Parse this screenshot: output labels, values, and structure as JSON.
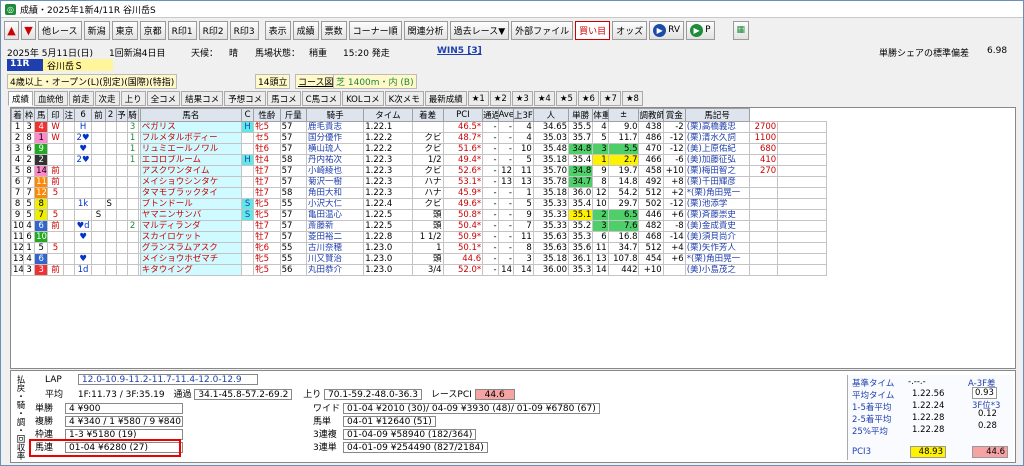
{
  "window": {
    "title": "成績・2025年1新4/11R 谷川岳S"
  },
  "toolbar": {
    "row1": [
      "他レース",
      "新潟",
      "東京",
      "京都",
      "R印1",
      "R印2",
      "R印3",
      "表示",
      "成績",
      "票数",
      "コーナー順",
      "関連分析",
      "過去レース▼",
      "外部ファイル",
      "買い目",
      "オッズ",
      "RV",
      "P"
    ]
  },
  "race": {
    "date": "2025年 5月11日(日)",
    "meeting": "1回新潟4日目",
    "weather_label": "天候：",
    "weather": "晴",
    "track_label": "馬場状態：",
    "track": "稍重",
    "start": "15:20 発走",
    "win5": "WIN5 [3]",
    "share_label": "単勝シェアの標準偏差",
    "share_value": "6.98",
    "number": "11R",
    "name": "谷川岳Ｓ",
    "condition": "4歳以上・オープン(L)(別定)(国際)(特指)",
    "runners": "14頭立",
    "course_label": "コース図",
    "course": "芝 1400m・内 (B)"
  },
  "tabs": [
    "成績",
    "血統他",
    "前走",
    "次走",
    "上り",
    "全コメ",
    "結果コメ",
    "予想コメ",
    "馬コメ",
    "C馬コメ",
    "KOLコメ",
    "K次メモ",
    "最新成績",
    "★1",
    "★2",
    "★3",
    "★4",
    "★5",
    "★6",
    "★7",
    "★8"
  ],
  "columns": [
    "着",
    "枠",
    "馬",
    "印",
    "注",
    "6",
    "前",
    "2",
    "予",
    "騎",
    "",
    "馬名",
    "C",
    "性齢",
    "斤量",
    "騎手",
    "タイム",
    "着差",
    "PCI",
    "通過順位",
    "Ave-3F",
    "上3F",
    "人",
    "単勝",
    "体重",
    "±",
    "調教師",
    "賞金",
    "馬記号"
  ],
  "rows": [
    [
      "1",
      "3",
      "4",
      "W",
      "",
      "H",
      "",
      "",
      "",
      "3",
      "",
      "ペガリス",
      "H",
      "牝5",
      "57",
      "鹿毛貴志",
      "1.22.1",
      "",
      "46.5*",
      "-",
      "-",
      "4",
      "34.65",
      "35.5",
      "4",
      "9.0",
      "438",
      "-2",
      "(栗)高橋義忠",
      "2700",
      ""
    ],
    [
      "2",
      "8",
      "1",
      "W",
      "",
      "2♥",
      "",
      "",
      "",
      "1",
      "",
      "フルメタルボディー",
      "",
      "セ5",
      "57",
      "国分優作",
      "1.22.2",
      "クビ",
      "48.7*",
      "-",
      "-",
      "4",
      "35.03",
      "35.7",
      "5",
      "11.7",
      "486",
      "-12",
      "(栗)清水久詞",
      "1100",
      ""
    ],
    [
      "3",
      "6",
      "9",
      "",
      "",
      "♥",
      "",
      "",
      "",
      "1",
      "",
      "リュミエールノワル",
      "",
      "牡6",
      "57",
      "横山琉人",
      "1.22.2",
      "クビ",
      "51.6*",
      "-",
      "-",
      "10",
      "35.48",
      "34.8",
      "3",
      "5.5",
      "470",
      "-12",
      "(美)上原佑紀",
      "680",
      ""
    ],
    [
      "4",
      "2",
      "2",
      "",
      "",
      "2♥",
      "",
      "",
      "",
      "1",
      "",
      "エコロブルーム",
      "H",
      "牡4",
      "58",
      "丹内祐次",
      "1.22.3",
      "1/2",
      "49.4*",
      "-",
      "-",
      "5",
      "35.18",
      "35.4",
      "1",
      "2.7",
      "466",
      "-6",
      "(美)加藤征弘",
      "410",
      ""
    ],
    [
      "5",
      "8",
      "14",
      "前",
      "",
      "",
      "",
      "",
      "",
      "",
      "",
      "アスクワンタイム",
      "",
      "牡7",
      "57",
      "小崎綾也",
      "1.22.3",
      "クビ",
      "52.6*",
      "-",
      "12",
      "11",
      "35.70",
      "34.8",
      "9",
      "19.7",
      "458",
      "+10",
      "(栗)梅田智之",
      "270",
      ""
    ],
    [
      "6",
      "7",
      "11",
      "前",
      "",
      "",
      "",
      "",
      "",
      "",
      "",
      "メイショウシンタケ",
      "",
      "牡7",
      "57",
      "菊沢一樹",
      "1.22.3",
      "ハナ",
      "53.1*",
      "-",
      "13",
      "13",
      "35.78",
      "34.7",
      "8",
      "14.8",
      "492",
      "+8",
      "(栗)千田輝彦",
      "",
      ""
    ],
    [
      "7",
      "7",
      "12",
      "5",
      "",
      "",
      "",
      "",
      "",
      "",
      "",
      "タマモブラックタイ",
      "",
      "牡7",
      "58",
      "角田大和",
      "1.22.3",
      "ハナ",
      "45.9*",
      "-",
      "-",
      "1",
      "35.18",
      "36.0",
      "12",
      "54.2",
      "512",
      "+2",
      "*(栗)角田晃一",
      "",
      ""
    ],
    [
      "8",
      "5",
      "8",
      "",
      "",
      "1k",
      "",
      "S",
      "",
      "",
      "",
      "ブトンドール",
      "S",
      "牝5",
      "55",
      "小沢大仁",
      "1.22.4",
      "クビ",
      "49.6*",
      "-",
      "-",
      "5",
      "35.33",
      "35.4",
      "10",
      "29.7",
      "502",
      "-12",
      "(栗)池添学",
      "",
      ""
    ],
    [
      "9",
      "5",
      "7",
      "5",
      "",
      "",
      "S",
      "",
      "",
      "",
      "",
      "ヤマニンサンバ",
      "S",
      "牝5",
      "57",
      "亀田温心",
      "1.22.5",
      "頭",
      "50.8*",
      "-",
      "-",
      "9",
      "35.33",
      "35.1",
      "2",
      "6.5",
      "446",
      "+6",
      "(栗)斉藤崇史",
      "",
      ""
    ],
    [
      "10",
      "4",
      "6",
      "前",
      "",
      "♥d",
      "",
      "",
      "",
      "2",
      "",
      "マルディランダ",
      "",
      "牡7",
      "57",
      "斎藤新",
      "1.22.5",
      "頭",
      "50.4*",
      "-",
      "-",
      "7",
      "35.33",
      "35.2",
      "3",
      "7.6",
      "482",
      "-8",
      "(美)金成貴史",
      "",
      ""
    ],
    [
      "11",
      "6",
      "10",
      "",
      "",
      "♥",
      "",
      "",
      "",
      "",
      "",
      "スカイロケット",
      "",
      "牡7",
      "57",
      "菱田裕二",
      "1.22.8",
      "1 1/2",
      "50.9*",
      "-",
      "-",
      "11",
      "35.63",
      "35.3",
      "6",
      "16.8",
      "468",
      "-14",
      "(美)須貝尚介",
      "",
      ""
    ],
    [
      "12",
      "1",
      "5",
      "5",
      "",
      "",
      "",
      "",
      "",
      "",
      "",
      "グランスラムアスク",
      "",
      "牝6",
      "55",
      "古川奈穂",
      "1.23.0",
      "1",
      "50.1*",
      "-",
      "-",
      "8",
      "35.63",
      "35.6",
      "11",
      "34.7",
      "512",
      "+4",
      "(栗)矢作芳人",
      "",
      ""
    ],
    [
      "13",
      "4",
      "6",
      "",
      "",
      "♥",
      "",
      "",
      "",
      "",
      "",
      "メイショウホゼマチ",
      "",
      "牝5",
      "55",
      "川又賢治",
      "1.23.0",
      "頭",
      "44.6",
      "-",
      "-",
      "3",
      "35.18",
      "36.1",
      "13",
      "107.8",
      "454",
      "+6",
      "*(栗)角田晃一",
      "",
      ""
    ],
    [
      "14",
      "3",
      "3",
      "前",
      "",
      "1d",
      "",
      "",
      "",
      "",
      "",
      "キタウイング",
      "",
      "牝5",
      "56",
      "丸田恭介",
      "1.23.0",
      "3/4",
      "52.0*",
      "-",
      "14",
      "14",
      "36.00",
      "35.3",
      "14",
      "442",
      "+10",
      "",
      "(美)小島茂之",
      "",
      ""
    ]
  ],
  "lap": {
    "label": "LAP",
    "values": "12.0-10.9-11.2-11.7-11.4-12.0-12.9"
  },
  "pace": {
    "label": "平均",
    "value": "1F:11.73 / 3F:35.19",
    "tsuka_label": "通過",
    "tsuka": "34.1-45.8-57.2-69.2",
    "agari_label": "上り",
    "agari": "70.1-59.2-48.0-36.3",
    "pci_label": "レースPCI",
    "pci": "44.6"
  },
  "payouts": [
    {
      "label": "単勝",
      "value": "4 ¥900"
    },
    {
      "label": "複勝",
      "value": "4 ¥340 / 1 ¥580 / 9 ¥840"
    },
    {
      "label": "枠連",
      "value": "1-3 ¥5180 (19)"
    },
    {
      "label": "馬連",
      "value": "01-04 ¥6280 (27)"
    }
  ],
  "payouts2": [
    {
      "label": "ワイド",
      "value": "01-04 ¥2010 (30)/ 04-09 ¥3930 (48)/ 01-09 ¥6780 (67)"
    },
    {
      "label": "馬単",
      "value": "04-01 ¥12640 (51)"
    },
    {
      "label": "3連複",
      "value": "01-04-09 ¥58940 (182/364)"
    },
    {
      "label": "3連単",
      "value": "04-01-09 ¥254490 (827/2184)"
    }
  ],
  "vertical_label": "払戻・騎・調・回収率",
  "standards": {
    "header": "基準タイム",
    "header_val": "-.--.-",
    "a3f_label": "A-3F差",
    "a3f": "0.93",
    "rows": [
      {
        "label": "平均タイム",
        "value": "1.22.56",
        "label2": "3F位*3",
        "value2": "0.12"
      },
      {
        "label": "1-5着平均",
        "value": "1.22.24",
        "label2": "",
        "value2": "0.28"
      },
      {
        "label": "2-5着平均",
        "value": "1.22.28",
        "label2": "",
        "value2": ""
      },
      {
        "label": "25%平均",
        "value": "1.22.28",
        "label2": "レースPCI",
        "value2": ""
      }
    ],
    "pci3_label": "PCI3",
    "pci3": "48.93",
    "pci": "44.6"
  }
}
